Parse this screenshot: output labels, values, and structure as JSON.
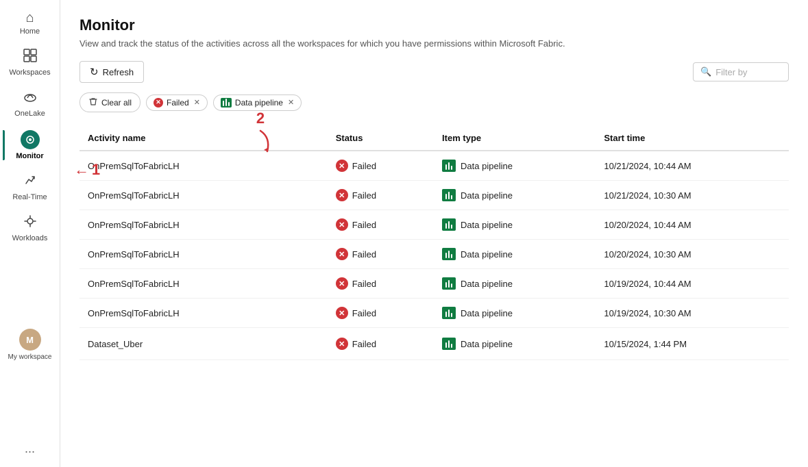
{
  "sidebar": {
    "items": [
      {
        "id": "home",
        "label": "Home",
        "icon": "⌂"
      },
      {
        "id": "workspaces",
        "label": "Workspaces",
        "icon": "🖥"
      },
      {
        "id": "onelake",
        "label": "OneLake",
        "icon": "☁"
      },
      {
        "id": "monitor",
        "label": "Monitor",
        "icon": "◉",
        "active": true
      },
      {
        "id": "realtime",
        "label": "Real-Time",
        "icon": "⚡"
      },
      {
        "id": "workloads",
        "label": "Workloads",
        "icon": "⚙"
      }
    ],
    "my_workspace_label": "My workspace",
    "more_label": "...",
    "avatar_initials": "M"
  },
  "header": {
    "title": "Monitor",
    "subtitle": "View and track the status of the activities across all the workspaces for which you have permissions within Microsoft Fabric."
  },
  "toolbar": {
    "refresh_label": "Refresh"
  },
  "filter_bar": {
    "clear_all_label": "Clear all",
    "chips": [
      {
        "id": "failed",
        "label": "Failed",
        "type": "status"
      },
      {
        "id": "data_pipeline",
        "label": "Data pipeline",
        "type": "item_type"
      }
    ],
    "filter_placeholder": "Filter by"
  },
  "table": {
    "columns": [
      "Activity name",
      "Status",
      "Item type",
      "Start time"
    ],
    "rows": [
      {
        "activity_name": "OnPremSqlToFabricLH",
        "status": "Failed",
        "item_type": "Data pipeline",
        "start_time": "10/21/2024, 10:44 AM",
        "show_actions": false
      },
      {
        "activity_name": "OnPremSqlToFabricLH",
        "status": "Failed",
        "item_type": "Data pipeline",
        "start_time": "10/21/2024, 10:30 AM",
        "show_actions": false
      },
      {
        "activity_name": "OnPremSqlToFabricLH",
        "status": "Failed",
        "item_type": "Data pipeline",
        "start_time": "10/20/2024, 10:44 AM",
        "show_actions": false
      },
      {
        "activity_name": "OnPremSqlToFabricLH",
        "status": "Failed",
        "item_type": "Data pipeline",
        "start_time": "10/20/2024, 10:30 AM",
        "show_actions": false
      },
      {
        "activity_name": "OnPremSqlToFabricLH",
        "status": "Failed",
        "item_type": "Data pipeline",
        "start_time": "10/19/2024, 10:44 AM",
        "show_actions": false
      },
      {
        "activity_name": "OnPremSqlToFabricLH",
        "status": "Failed",
        "item_type": "Data pipeline",
        "start_time": "10/19/2024, 10:30 AM",
        "show_actions": false
      },
      {
        "activity_name": "Dataset_Uber",
        "status": "Failed",
        "item_type": "Data pipeline",
        "start_time": "10/15/2024, 1:44 PM",
        "show_actions": true
      }
    ]
  },
  "annotations": {
    "arrow1_label": "1",
    "arrow2_label": "2"
  }
}
